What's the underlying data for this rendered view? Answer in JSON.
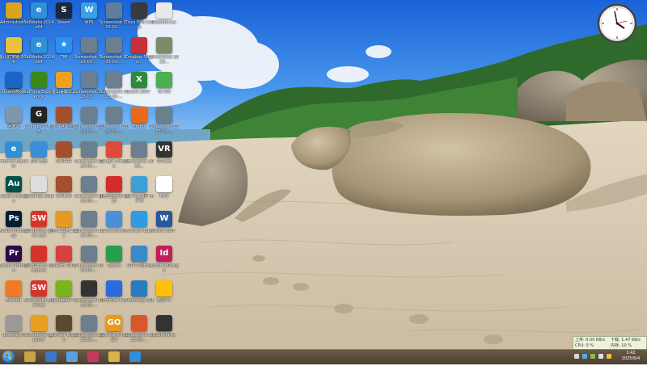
{
  "desktop": {
    "icons": [
      {
        "label": "Administrator",
        "icon": "folder-user-icon",
        "color": "#d9a521",
        "glyph": ""
      },
      {
        "label": "SldWorks 2014 x64",
        "icon": "ie-icon",
        "color": "#2f8fd8",
        "glyph": "e"
      },
      {
        "label": "Steam",
        "icon": "steam-icon",
        "color": "#1b2838",
        "glyph": "S"
      },
      {
        "label": "WPS",
        "icon": "wps-icon",
        "color": "#3aa0e8",
        "glyph": "W"
      },
      {
        "label": "Screenshot 2023-03-...",
        "icon": "screenshot-icon",
        "color": "#5f7d9c",
        "glyph": ""
      },
      {
        "label": "Cisco VPN Client",
        "icon": "vpn-icon",
        "color": "#3a3a3a",
        "glyph": ""
      },
      {
        "label": "Readme.txt",
        "icon": "text-file-icon",
        "color": "#e8e8e8",
        "glyph": ""
      },
      {
        "label": "计算机",
        "icon": "computer-icon",
        "color": "#3c77c6",
        "glyph": ""
      },
      {
        "label": "SldWorks 2014 x64",
        "icon": "ie-icon",
        "color": "#2f8fd8",
        "glyph": "e"
      },
      {
        "label": "TIM",
        "icon": "tim-icon",
        "color": "#2a8ff0",
        "glyph": "★"
      },
      {
        "label": "Screenshot 2023-03-...",
        "icon": "screenshot-icon",
        "color": "#6b7f8f",
        "glyph": ""
      },
      {
        "label": "Screenshot 2023-03-...",
        "icon": "screenshot-icon",
        "color": "#6b7f8f",
        "glyph": ""
      },
      {
        "label": "Dropbox Share...",
        "icon": "share-icon",
        "color": "#c92f3a",
        "glyph": ""
      },
      {
        "label": "Screenshot 2023...",
        "icon": "screenshot-icon",
        "color": "#7a8c6a",
        "glyph": ""
      },
      {
        "label": "金山打字通 2016",
        "icon": "typing-icon",
        "color": "#e8c23a",
        "glyph": ""
      },
      {
        "label": "网络",
        "icon": "network-icon",
        "color": "#2a6bc2",
        "glyph": ""
      },
      {
        "label": "GeForce Experience",
        "icon": "nvidia-icon",
        "color": "#3a8a1a",
        "glyph": ""
      },
      {
        "label": "金山毒霸工具",
        "icon": "antivirus-icon",
        "color": "#f0a020",
        "glyph": ""
      },
      {
        "label": "Screenshot 2023-03-...",
        "icon": "screenshot-icon",
        "color": "#6b7f8f",
        "glyph": ""
      },
      {
        "label": "Screenshot 2023-03-...",
        "icon": "screenshot-icon",
        "color": "#6b7f8f",
        "glyph": ""
      },
      {
        "label": "Excel 2007",
        "icon": "excel-icon",
        "color": "#2e8b3d",
        "glyph": "X"
      },
      {
        "label": "Ya Mei",
        "icon": "yamei-icon",
        "color": "#4caf50",
        "glyph": ""
      },
      {
        "label": "Steam Mods",
        "icon": "browser-icon",
        "color": "#1e63c8",
        "glyph": ""
      },
      {
        "label": "回收站",
        "icon": "recycle-bin-icon",
        "color": "#7f96ad",
        "glyph": ""
      },
      {
        "label": "Logitech G HUB",
        "icon": "logitech-icon",
        "color": "#222222",
        "glyph": "G"
      },
      {
        "label": "WinRAR 压缩",
        "icon": "winrar-icon",
        "color": "#a4502c",
        "glyph": ""
      },
      {
        "label": "Screenshot 2023-03-...",
        "icon": "screenshot-icon",
        "color": "#6b7f8f",
        "glyph": ""
      },
      {
        "label": "Screenshot 2023-03-...",
        "icon": "screenshot-icon",
        "color": "#6b7f8f",
        "glyph": ""
      },
      {
        "label": "Firefox",
        "icon": "firefox-icon",
        "color": "#e86a1a",
        "glyph": ""
      },
      {
        "label": "Screenshot 2023-03-...",
        "icon": "screenshot-icon",
        "color": "#6b7f8f",
        "glyph": ""
      },
      {
        "label": "Internet Explorer",
        "icon": "ie-icon",
        "color": "#2f8fd8",
        "glyph": "e"
      },
      {
        "label": "360 安全",
        "icon": "browser-icon",
        "color": "#3b8ed8",
        "glyph": ""
      },
      {
        "label": "WinRAR",
        "icon": "winrar-icon",
        "color": "#a4502c",
        "glyph": ""
      },
      {
        "label": "Screenshot 2023-03-...",
        "icon": "screenshot-icon",
        "color": "#6b7f8f",
        "glyph": ""
      },
      {
        "label": "Google Chrome",
        "icon": "chrome-icon",
        "color": "#dd4b39",
        "glyph": ""
      },
      {
        "label": "Screenshot 2023...",
        "icon": "screenshot-icon",
        "color": "#6b7f8f",
        "glyph": ""
      },
      {
        "label": "VRChat",
        "icon": "vr-icon",
        "color": "#333333",
        "glyph": "VR"
      },
      {
        "label": "Adobe Audition",
        "icon": "audition-icon",
        "color": "#00514c",
        "glyph": "Au"
      },
      {
        "label": "SketchUp 2018",
        "icon": "sketchup-icon",
        "color": "#dddddd",
        "glyph": ""
      },
      {
        "label": "WinRAR",
        "icon": "winrar-icon",
        "color": "#a4502c",
        "glyph": ""
      },
      {
        "label": "Screenshot 2023-03-...",
        "icon": "screenshot-icon",
        "color": "#6b7f8f",
        "glyph": ""
      },
      {
        "label": "红色企业演讲 2023",
        "icon": "red-circle-icon",
        "color": "#d42c2c",
        "glyph": ""
      },
      {
        "label": "iSpring 翻页 电子书",
        "icon": "ebook-icon",
        "color": "#3ba0d8",
        "glyph": ""
      },
      {
        "label": "MKV",
        "icon": "mkv-icon",
        "color": "#ffffff",
        "glyph": ""
      },
      {
        "label": "Adobe Photoshop",
        "icon": "photoshop-icon",
        "color": "#001e36",
        "glyph": "Ps"
      },
      {
        "label": "SolidWorks 2014 x64",
        "icon": "solidworks-icon",
        "color": "#d6332a",
        "glyph": "SW"
      },
      {
        "label": "图形工具箱 2021",
        "icon": "toolbox-icon",
        "color": "#e59a25",
        "glyph": ""
      },
      {
        "label": "Screenshot 2023-03-...",
        "icon": "screenshot-icon",
        "color": "#6b7f8f",
        "glyph": ""
      },
      {
        "label": "Screenshot",
        "icon": "screenshot-icon",
        "color": "#4a90d9",
        "glyph": ""
      },
      {
        "label": "Microsoft Edge",
        "icon": "edge-icon",
        "color": "#2f9be0",
        "glyph": ""
      },
      {
        "label": "Word 2007",
        "icon": "word-icon",
        "color": "#2b579a",
        "glyph": "W"
      },
      {
        "label": "Adobe Premiere",
        "icon": "premiere-icon",
        "color": "#2a0b47",
        "glyph": "Pr"
      },
      {
        "label": "SolidWorks Composer",
        "icon": "solidworks-icon",
        "color": "#d6332a",
        "glyph": ""
      },
      {
        "label": "Steam 2007",
        "icon": "ie-icon",
        "color": "#d94040",
        "glyph": ""
      },
      {
        "label": "Screenshot 2023-03-...",
        "icon": "screenshot-icon",
        "color": "#6b7f8f",
        "glyph": ""
      },
      {
        "label": "Typora",
        "icon": "app-icon",
        "color": "#2a9d4f",
        "glyph": ""
      },
      {
        "label": "WPS Ribbon",
        "icon": "wps-icon",
        "color": "#3a8ac8",
        "glyph": ""
      },
      {
        "label": "Adobe InDesign",
        "icon": "indesign-icon",
        "color": "#c21f5a",
        "glyph": "Id"
      },
      {
        "label": "Blender",
        "icon": "blender-icon",
        "color": "#f17b24",
        "glyph": ""
      },
      {
        "label": "SolidWorks Electrical",
        "icon": "solidworks-icon",
        "color": "#d6332a",
        "glyph": "SW"
      },
      {
        "label": "Notepad++",
        "icon": "notepad-icon",
        "color": "#7ab51d",
        "glyph": ""
      },
      {
        "label": "Screenshot 2023-03-...",
        "icon": "screenshot-icon",
        "color": "#333333",
        "glyph": ""
      },
      {
        "label": "Premier Pro",
        "icon": "premiere-icon",
        "color": "#2a6be0",
        "glyph": ""
      },
      {
        "label": "Photoshop CS6",
        "icon": "photoshop-icon",
        "color": "#2a7cbf",
        "glyph": ""
      },
      {
        "label": "微信 PC",
        "icon": "wechat-icon",
        "color": "#ffc107",
        "glyph": ""
      },
      {
        "label": "desktop.ini",
        "icon": "ini-file-icon",
        "color": "#999999",
        "glyph": ""
      },
      {
        "label": "SolidWorks Explorer",
        "icon": "solidworks-icon",
        "color": "#e8a020",
        "glyph": ""
      },
      {
        "label": "Blender Engine",
        "icon": "engine-icon",
        "color": "#5d4a2e",
        "glyph": ""
      },
      {
        "label": "Screenshot 2023-03-...",
        "icon": "screenshot-icon",
        "color": "#6b7f8f",
        "glyph": ""
      },
      {
        "label": "Counter-Strike GO",
        "icon": "csgo-icon",
        "color": "#e89a1a",
        "glyph": "GO"
      },
      {
        "label": "Screenshot 2023-03-...",
        "icon": "screenshot-icon",
        "color": "#d9572a",
        "glyph": ""
      },
      {
        "label": "Bookmarks",
        "icon": "bookmark-icon",
        "color": "#333333",
        "glyph": ""
      }
    ],
    "column_counts": [
      7,
      8,
      8,
      7,
      7,
      7,
      7,
      7,
      7,
      7
    ]
  },
  "clock": {
    "time_hint": "4:42"
  },
  "net_monitor": {
    "upload": "上传: 0.00 KB/s",
    "download": "下载: 1.47 KB/s",
    "cpu": "CPU: 0 %",
    "memory": "内存: 10 %"
  },
  "taskbar": {
    "time": "1:42",
    "date": "2025/6/4",
    "pinned": [
      {
        "icon": "user-folder-icon",
        "color": "#c9a24a"
      },
      {
        "icon": "network-icon",
        "color": "#3c77c6"
      },
      {
        "icon": "browser-icon",
        "color": "#5aa0e0"
      },
      {
        "icon": "media-player-icon",
        "color": "#c23a5e"
      },
      {
        "icon": "explorer-icon",
        "color": "#d9b34a"
      },
      {
        "icon": "edge-icon",
        "color": "#2f8fd8"
      }
    ]
  }
}
